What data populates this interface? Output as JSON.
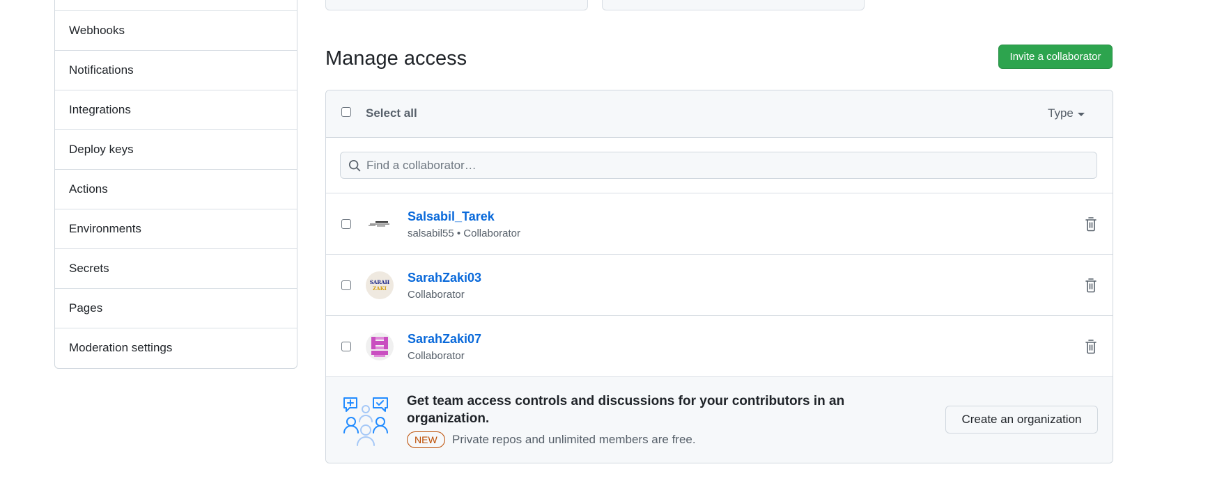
{
  "sidebar": {
    "items": [
      {
        "label": "Webhooks"
      },
      {
        "label": "Notifications"
      },
      {
        "label": "Integrations"
      },
      {
        "label": "Deploy keys"
      },
      {
        "label": "Actions"
      },
      {
        "label": "Environments"
      },
      {
        "label": "Secrets"
      },
      {
        "label": "Pages"
      },
      {
        "label": "Moderation settings"
      }
    ]
  },
  "main": {
    "title": "Manage access",
    "invite_label": "Invite a collaborator",
    "select_all_label": "Select all",
    "type_filter_label": "Type",
    "search": {
      "placeholder": "Find a collaborator…",
      "value": ""
    },
    "collaborators": [
      {
        "name": "Salsabil_Tarek",
        "subtitle": "salsabil55 • Collaborator"
      },
      {
        "name": "SarahZaki03",
        "subtitle": "Collaborator",
        "avatar_text_line1": "SARAH",
        "avatar_text_line2": "ZAKI"
      },
      {
        "name": "SarahZaki07",
        "subtitle": "Collaborator"
      }
    ],
    "promo": {
      "title": "Get team access controls and discussions for your contributors in an organization.",
      "badge": "NEW",
      "subtitle": "Private repos and unlimited members are free.",
      "button_label": "Create an organization"
    }
  },
  "colors": {
    "accent_green": "#2da44e",
    "link_blue": "#0969da",
    "badge_orange": "#bc4c00",
    "icon_blue": "#218bff"
  }
}
